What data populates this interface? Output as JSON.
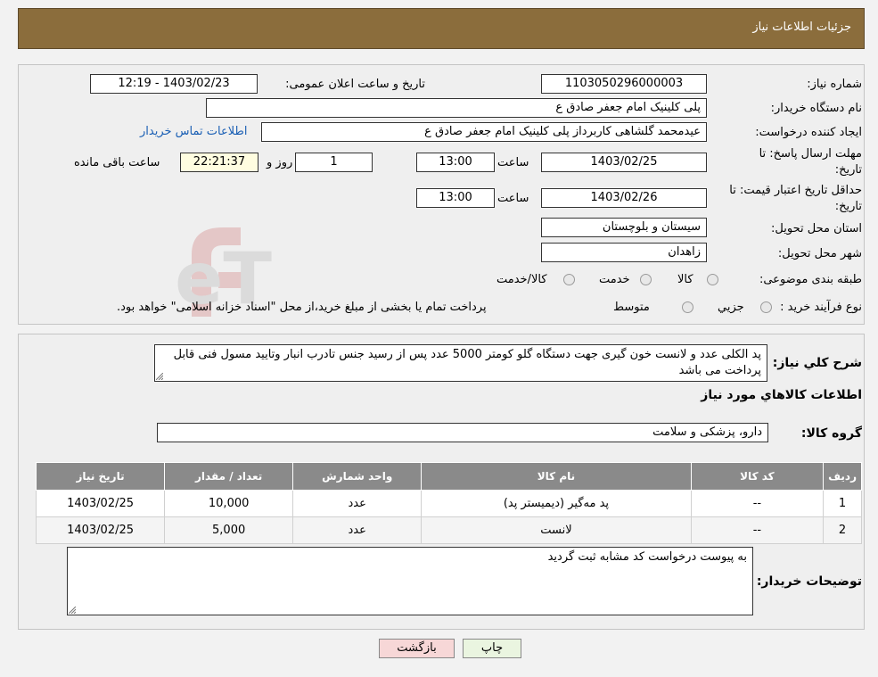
{
  "header": {
    "title": "جزئیات اطلاعات نیاز"
  },
  "labels": {
    "need_number": "شماره نیاز:",
    "announce_datetime": "تاریخ و ساعت اعلان عمومی:",
    "buyer_org": "نام دستگاه خریدار:",
    "requester": "ایجاد کننده درخواست:",
    "contact_link": "اطلاعات تماس خریدار",
    "reply_deadline_1": "مهلت ارسال پاسخ: تا",
    "reply_deadline_2": "تاریخ:",
    "time_word": "ساعت",
    "day_and": "روز و",
    "time_remaining": "ساعت باقی مانده",
    "price_validity_1": "حداقل تاریخ اعتبار قیمت: تا",
    "price_validity_2": "تاریخ:",
    "province": "استان محل تحویل:",
    "city": "شهر محل تحویل:",
    "category": "طبقه بندی موضوعی:",
    "process_type": "نوع فرآیند خرید :",
    "general_desc": "شرح کلي نياز:",
    "goods_info": "اطلاعات کالاهاي مورد نياز",
    "goods_group": "گروه کالا:",
    "buyer_notes": "توضیحات خریدار:"
  },
  "values": {
    "need_number": "1103050296000003",
    "announce_datetime": "1403/02/23 - 12:19",
    "buyer_org": "پلی کلینیک امام جعفر صادق ع",
    "requester": "عیدمحمد گلشاهی کاربرداز پلی کلینیک امام جعفر صادق ع",
    "reply_date": "1403/02/25",
    "reply_time": "13:00",
    "days": "1",
    "remaining": "22:21:37",
    "validity_date": "1403/02/26",
    "validity_time": "13:00",
    "province": "سیستان و بلوچستان",
    "city": "زاهدان",
    "general_desc": "پد الکلی  عدد و لانست خون گیری جهت دستگاه گلو کومتر 5000 عدد پس از رسید جنس تادرب انبار وتایید مسول فنی قابل پرداخت می باشد",
    "goods_group": "دارو، پزشکی و سلامت",
    "buyer_notes": "به پیوست درخواست کد مشابه ثبت گردید"
  },
  "category_options": [
    "کالا",
    "خدمت",
    "کالا/خدمت"
  ],
  "process_options": [
    "جزیي",
    "متوسط"
  ],
  "process_note": "پرداخت تمام یا بخشی از مبلغ خرید،از محل \"اسناد خزانه اسلامی\" خواهد بود.",
  "watermark": "AriaTender.neT",
  "table": {
    "headers": [
      "ردیف",
      "کد کالا",
      "نام کالا",
      "واحد شمارش",
      "تعداد / مقدار",
      "تاریخ نیاز"
    ],
    "rows": [
      [
        "1",
        "--",
        "پد مه‌گیر (دیمیستر پد)",
        "عدد",
        "10,000",
        "1403/02/25"
      ],
      [
        "2",
        "--",
        "لانست",
        "عدد",
        "5,000",
        "1403/02/25"
      ]
    ]
  },
  "buttons": {
    "print": "چاپ",
    "back": "بازگشت"
  },
  "colors": {
    "header_bg": "#8b6d3c",
    "link": "#1a5fb4",
    "back_button": "#f7d7d7",
    "print_button": "#eaf5e0"
  }
}
